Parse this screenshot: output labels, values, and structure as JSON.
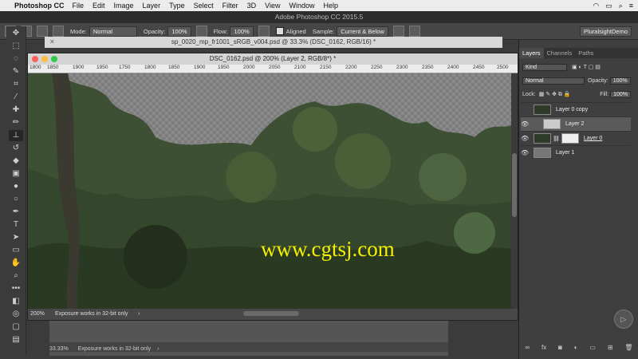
{
  "menubar": {
    "app_name": "Photoshop CC",
    "items": [
      "File",
      "Edit",
      "Image",
      "Layer",
      "Type",
      "Select",
      "Filter",
      "3D",
      "View",
      "Window",
      "Help"
    ],
    "status_icons": [
      "wifi-icon",
      "battery-icon",
      "search-icon",
      "menu-icon"
    ]
  },
  "window_title": "Adobe Photoshop CC 2015.5",
  "options": {
    "mode_label": "Mode:",
    "mode_value": "Normal",
    "opacity_label": "Opacity:",
    "opacity_value": "100%",
    "flow_label": "Flow:",
    "flow_value": "100%",
    "aligned_label": "Aligned",
    "sample_label": "Sample:",
    "sample_value": "Current & Below",
    "workspace": "PluralsightDemo"
  },
  "tools": [
    "move",
    "marquee",
    "lasso",
    "quick-select",
    "crop",
    "eyedropper",
    "healing",
    "brush",
    "clone-stamp",
    "history-brush",
    "eraser",
    "gradient",
    "blur",
    "dodge",
    "pen",
    "type",
    "path-select",
    "rectangle",
    "hand",
    "zoom",
    "more",
    "colors",
    "quick-mask",
    "screen-mode",
    "artboard"
  ],
  "doc_back_title": "sp_0020_mp_fr1001_sRGB_v004.psd @ 33.3% (DSC_0162, RGB/16) *",
  "doc_main_title": "DSC_0162.psd @ 200% (Layer 2, RGB/8*) *",
  "ruler_ticks": [
    "1800",
    "1850",
    "1900",
    "1950",
    "1750",
    "1800",
    "1850",
    "1900",
    "1950",
    "2000",
    "2050",
    "2100",
    "2150",
    "2200",
    "2250",
    "2300",
    "2350",
    "2400",
    "2450",
    "2500"
  ],
  "doc_status": {
    "zoom": "200%",
    "message": "Exposure works in 32-bit only",
    "arrow": "›"
  },
  "bottom_status": {
    "zoom": "33.33%",
    "message": "Exposure works in 32-bit only",
    "arrow": "›"
  },
  "watermark": "www.cgtsj.com",
  "layers_panel": {
    "tabs": [
      "Layers",
      "Channels",
      "Paths"
    ],
    "filter_value": "Kind",
    "blend_value": "Normal",
    "opacity_label": "Opacity:",
    "opacity_value": "100%",
    "lock_label": "Lock:",
    "fill_label": "Fill:",
    "fill_value": "100%",
    "layers": [
      {
        "name": "Layer 0 copy",
        "visible": false
      },
      {
        "name": "Layer 2",
        "visible": true
      },
      {
        "name": "Layer 0",
        "visible": true
      },
      {
        "name": "Layer 1",
        "visible": true
      }
    ],
    "footer_icons": [
      "link-icon",
      "fx-icon",
      "mask-icon",
      "adjustment-icon",
      "folder-icon",
      "new-layer-icon",
      "trash-icon"
    ]
  },
  "colors": {
    "menubar": "#ececec",
    "panel": "#3f3f3f",
    "watermark": "#f5f000"
  }
}
